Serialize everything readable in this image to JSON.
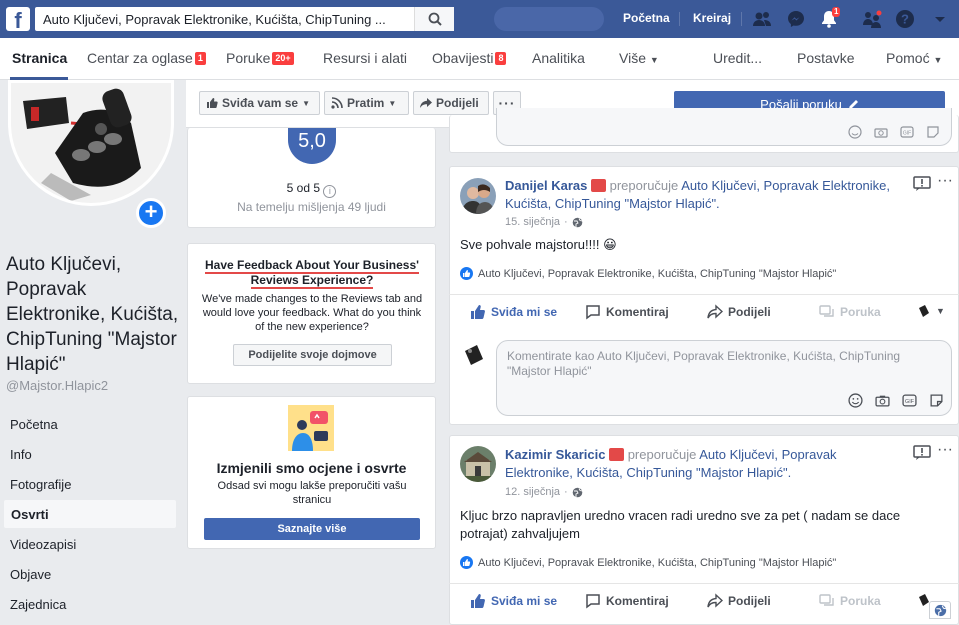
{
  "search": {
    "value": "Auto Ključevi, Popravak Elektronike, Kućišta, ChipTuning ..."
  },
  "topnav": {
    "home": "Početna",
    "create": "Kreiraj",
    "notif_count": "1"
  },
  "subnav": {
    "tabs": [
      {
        "label": "Stranica"
      },
      {
        "label": "Centar za oglase",
        "badge": "1"
      },
      {
        "label": "Poruke",
        "badge": "20+"
      },
      {
        "label": "Resursi i alati"
      },
      {
        "label": "Obavijesti",
        "badge": "8"
      },
      {
        "label": "Analitika"
      },
      {
        "label": "Više"
      },
      {
        "label": "Uredit..."
      },
      {
        "label": "Postavke"
      },
      {
        "label": "Pomoć"
      }
    ]
  },
  "page": {
    "name": "Auto Ključevi, Popravak Elektronike, Kućišta, ChipTuning \"Majstor Hlapić\"",
    "handle": "@Majstor.Hlapic2"
  },
  "leftnav": [
    "Početna",
    "Info",
    "Fotografije",
    "Osvrti",
    "Videozapisi",
    "Objave",
    "Zajednica"
  ],
  "actions": {
    "like": "Sviđa vam se",
    "follow": "Pratim",
    "share": "Podijeli",
    "send_message": "Pošalji poruku"
  },
  "rating": {
    "score": "5,0",
    "out_of": "5 od 5",
    "based_on": "Na temelju mišljenja 49 ljudi"
  },
  "feedback": {
    "title": "Have Feedback About Your Business' Reviews Experience?",
    "body": "We've made changes to the Reviews tab and would love your feedback. What do you think of the new experience?",
    "button": "Podijelite svoje dojmove"
  },
  "changed": {
    "title": "Izmjenili smo ocjene i osvrte",
    "body": "Odsad svi mogu lakše preporučiti vašu stranicu",
    "button": "Saznajte više"
  },
  "posts": [
    {
      "author": "Danijel Karas",
      "verb": "preporučuje",
      "page": "Auto Ključevi, Popravak Elektronike, Kućišta, ChipTuning \"Majstor Hlapić\".",
      "date": "15. siječnja",
      "text": "Sve pohvale majstoru!!!! 😀",
      "tag": "Auto Ključevi, Popravak Elektronike, Kućišta, ChipTuning \"Majstor Hlapić\""
    },
    {
      "author": "Kazimir Skaricic",
      "verb": "preporučuje",
      "page": "Auto Ključevi, Popravak Elektronike, Kućišta, ChipTuning \"Majstor Hlapić\".",
      "date": "12. siječnja",
      "text": "Kljuc brzo napravljen uredno vracen radi uredno sve za pet ( nadam se dace potrajat) zahvaljujem",
      "tag": "Auto Ključevi, Popravak Elektronike, Kućišta, ChipTuning \"Majstor Hlapić\""
    }
  ],
  "post_actions": {
    "like": "Sviđa mi se",
    "comment": "Komentiraj",
    "share": "Podijeli",
    "message": "Poruka"
  },
  "comment": {
    "placeholder": "Komentirate kao Auto Ključevi, Popravak Elektronike, Kućišta, ChipTuning \"Majstor Hlapić\""
  },
  "colors": {
    "brand": "#3b5998",
    "button_blue": "#4267b2",
    "badge_red": "#fa3e3e"
  }
}
